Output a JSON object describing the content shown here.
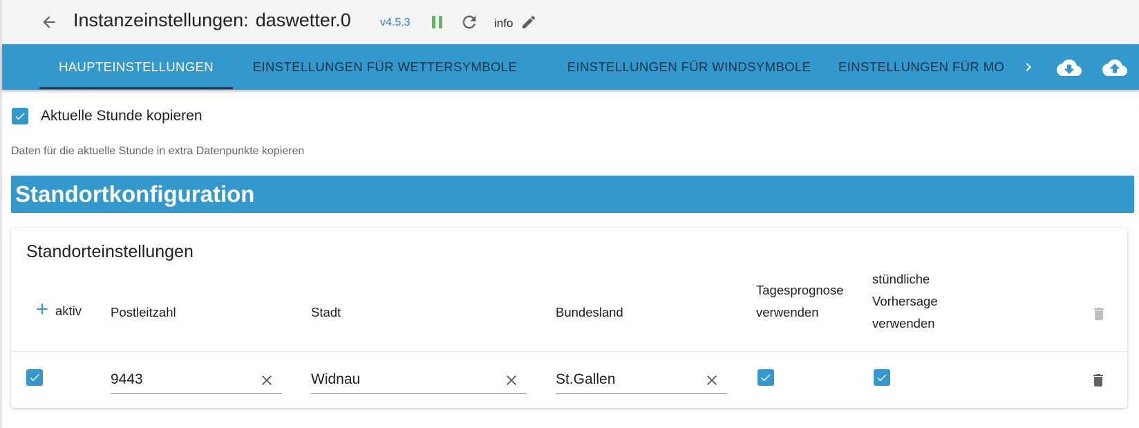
{
  "header": {
    "title": "Instanzeinstellungen:",
    "instance": "daswetter.0",
    "version": "v4.5.3",
    "info_label": "info"
  },
  "tabs": [
    {
      "label": "HAUPTEINSTELLUNGEN",
      "active": true
    },
    {
      "label": "EINSTELLUNGEN FÜR WETTERSYMBOLE",
      "active": false
    },
    {
      "label": "EINSTELLUNGEN FÜR WINDSYMBOLE",
      "active": false
    },
    {
      "label": "EINSTELLUNGEN FÜR MO",
      "active": false
    }
  ],
  "options": {
    "copy_hour_label": "Aktuelle Stunde kopieren",
    "copy_hour_checked": true,
    "copy_hour_help": "Daten für die aktuelle Stunde in extra Datenpunkte kopieren"
  },
  "section": {
    "title": "Standortkonfiguration"
  },
  "locations": {
    "title": "Standorteinstellungen",
    "columns": {
      "active": "aktiv",
      "zip": "Postleitzahl",
      "city": "Stadt",
      "state": "Bundesland",
      "daily": [
        "Tagesprognose",
        "verwenden"
      ],
      "hourly": [
        "stündliche",
        "Vorhersage",
        "verwenden"
      ]
    },
    "rows": [
      {
        "active": true,
        "zip": "9443",
        "city": "Widnau",
        "state": "St.Gallen",
        "daily": true,
        "hourly": true
      }
    ]
  },
  "colors": {
    "accent": "#3399cc",
    "version_text": "#2d7bc4",
    "running_green": "#5cb85c",
    "tab_text": "#10344b",
    "tab_indicator": "#1d3f66"
  },
  "icons": {
    "back": "arrow-left-icon",
    "pause": "pause-icon",
    "reload": "reload-icon",
    "edit": "pencil-icon",
    "tab_scroll": "chevron-right-icon",
    "download": "cloud-download-icon",
    "upload": "cloud-upload-icon",
    "add": "plus-icon",
    "clear": "close-icon",
    "delete": "trash-icon"
  }
}
